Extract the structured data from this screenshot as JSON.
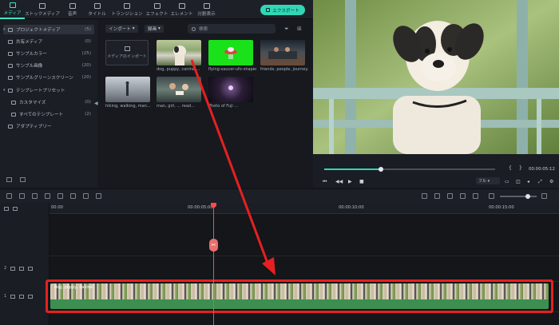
{
  "tabs": [
    {
      "label": "メディア",
      "icon": "media-icon",
      "active": true
    },
    {
      "label": "ストックメディア",
      "icon": "stock-media-icon",
      "active": false
    },
    {
      "label": "音声",
      "icon": "audio-icon",
      "active": false
    },
    {
      "label": "タイトル",
      "icon": "title-icon",
      "active": false
    },
    {
      "label": "トランジション",
      "icon": "transition-icon",
      "active": false
    },
    {
      "label": "エフェクト",
      "icon": "effect-icon",
      "active": false
    },
    {
      "label": "エレメント",
      "icon": "element-icon",
      "active": false
    },
    {
      "label": "分割表示",
      "icon": "split-screen-icon",
      "active": false
    }
  ],
  "export_label": "エクスポート",
  "sidebar": {
    "items": [
      {
        "label": "プロジェクトメディア",
        "count": "(5)"
      },
      {
        "label": "共有メディア",
        "count": "(0)"
      },
      {
        "label": "サンプルカラー",
        "count": "(25)"
      },
      {
        "label": "サンプル画像",
        "count": "(20)"
      },
      {
        "label": "サンプルグリーンスクリーン",
        "count": "(20)"
      },
      {
        "label": "テンプレートプリセット",
        "count": ""
      },
      {
        "label": "カスタマイズ",
        "count": "(0)"
      },
      {
        "label": "すべてのテンプレート",
        "count": "(2)"
      },
      {
        "label": "アダプティブリー",
        "count": ""
      }
    ]
  },
  "media": {
    "import_dropdown": "インポート",
    "record_dropdown": "録画",
    "search_placeholder": "検索",
    "import_tile_label": "メディアのインポート",
    "items": [
      {
        "label": "dog, puppy, canine ..."
      },
      {
        "label": "flying-saucer-ufo-shaped..."
      },
      {
        "label": "friends, people, journey..."
      },
      {
        "label": "hiking, walking, man..."
      },
      {
        "label": "man, girl, ... read..."
      },
      {
        "label": "Photo of Fuji ..."
      }
    ]
  },
  "preview": {
    "timecode": "00:00:05:12",
    "zoom": "フル",
    "progress": 0.33
  },
  "timeline": {
    "timecodes": [
      "00:00",
      "00:00:05:00",
      "00:00:10:00",
      "00:00:15:00"
    ],
    "tracks": [
      "2",
      "1"
    ],
    "clip_title": "dog, puppy, canine"
  },
  "colors": {
    "accent": "#31d6b4",
    "playhead": "#ff4b4b",
    "highlight": "#e62020"
  }
}
